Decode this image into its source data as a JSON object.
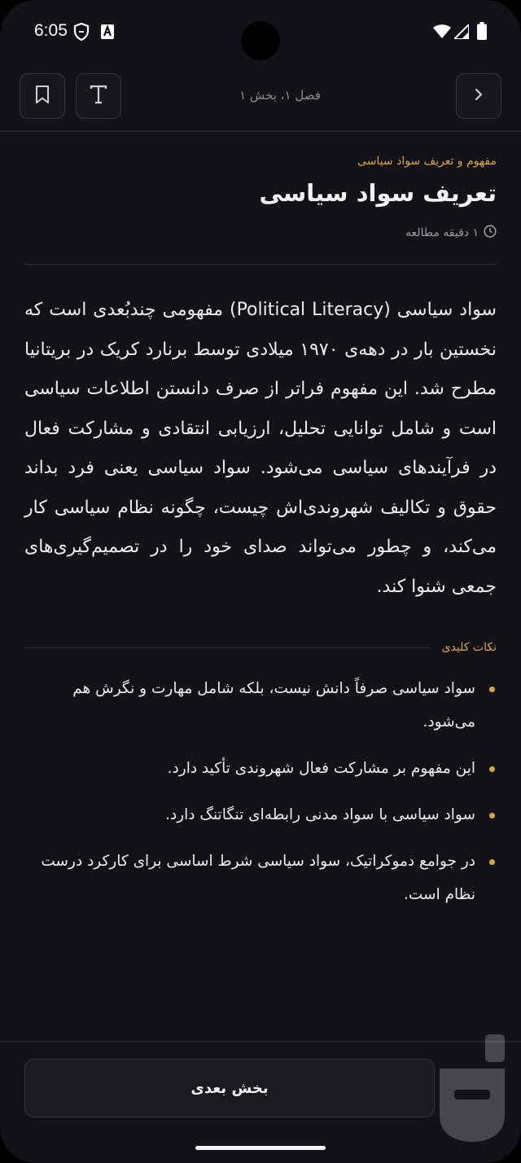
{
  "status": {
    "time": "6:05"
  },
  "header": {
    "location": "فصل ۱، بخش ۱",
    "back_icon": "chevron-right-icon",
    "font_icon": "text-size-icon",
    "bookmark_icon": "bookmark-icon"
  },
  "lesson": {
    "category": "مفهوم و تعریف سواد سیاسی",
    "title": "تعریف سواد سیاسی",
    "read_time": "۱ دقیقه مطالعه",
    "body": "سواد سیاسی (Political Literacy) مفهومی چندبُعدی است که نخستین بار در دهه‌ی ۱۹۷۰ میلادی توسط برنارد کریک در بریتانیا مطرح شد. این مفهوم فراتر از صرف دانستن اطلاعات سیاسی است و شامل توانایی تحلیل، ارزیابی انتقادی و مشارکت فعال در فرآیندهای سیاسی می‌شود. سواد سیاسی یعنی فرد بداند حقوق و تکالیف شهروندی‌اش چیست، چگونه نظام سیاسی کار می‌کند، و چطور می‌تواند صدای خود را در تصمیم‌گیری‌های جمعی شنوا کند."
  },
  "key_points": {
    "heading": "نکات کلیدی",
    "items": [
      "سواد سیاسی صرفاً دانش نیست، بلکه شامل مهارت و نگرش هم می‌شود.",
      "این مفهوم بر مشارکت فعال شهروندی تأکید دارد.",
      "سواد سیاسی با سواد مدنی رابطه‌ای تنگاتنگ دارد.",
      "در جوامع دموکراتیک، سواد سیاسی شرط اساسی برای کارکرد درست نظام است."
    ]
  },
  "footer": {
    "next_label": "بخش بعدی"
  },
  "colors": {
    "accent": "#d8a63a",
    "background": "#121218"
  }
}
